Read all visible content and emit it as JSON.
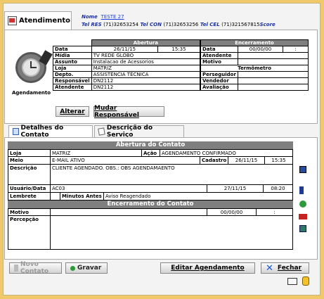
{
  "header": {
    "tab_label": "Atendimento",
    "nome_label": "Nome",
    "nome_value": "TESTE 27",
    "tel_res_label": "Tel RES",
    "tel_res_value": "(71)32653254",
    "tel_con_label": "Tel CON",
    "tel_con_value": "(71)32653256",
    "tel_cel_label": "Tel CEL",
    "tel_cel_value": "(71)321567815",
    "score_label": "Score"
  },
  "agendamento": {
    "label": "Agendamento",
    "abertura_header": "Abertura",
    "encerramento_header": "Encerramento",
    "termometro_header": "Termômetro",
    "data_label": "Data",
    "data_value": "26/11/15",
    "hora_value": "15:35",
    "midia_label": "Mídia",
    "midia_value": "TV REDE GLOBO",
    "assunto_label": "Assunto",
    "assunto_value": "Instalacao de Acessorios",
    "loja_label": "Loja",
    "loja_value": "MATRIZ",
    "depto_label": "Depto.",
    "depto_value": "ASSISTÊNCIA TÉCNICA",
    "responsavel_label": "Responsável",
    "responsavel_value": "DN2112",
    "atendente_label": "Atendente",
    "atendente_value": "DN2112",
    "enc_data_label": "Data",
    "enc_data_value": "00/00/00",
    "enc_hora_value": ":",
    "enc_atendente_label": "Atendente",
    "enc_motivo_label": "Motivo",
    "perseguidor_label": "Perseguidor",
    "vendedor_label": "Vendedor",
    "avaliacao_label": "Avaliação",
    "alterar_button": "Alterar",
    "mudar_button": "Mudar Responsável"
  },
  "tabs": {
    "detalhes": "Detalhes do Contato",
    "descricao": "Descrição do Serviço"
  },
  "contato": {
    "abertura_header": "Abertura do Contato",
    "loja_label": "Loja",
    "loja_value": "MATRIZ",
    "acao_label": "Ação",
    "acao_value": "AGENDAMENTO CONFIRMADO",
    "meio_label": "Meio",
    "meio_value": "E-MAIL ATIVO",
    "cadastro_label": "Cadastro",
    "cadastro_date": "26/11/15",
    "cadastro_time": "15:35",
    "descricao_label": "Descrição",
    "descricao_value": "CLIENTE AGENDADO. OBS.: OBS AGENDAMAENTO",
    "usuario_label": "Usuário/Data",
    "usuario_value": "AC03",
    "usuario_date": "27/11/15",
    "usuario_time": "08:20",
    "lembrete_label": "Lembrete",
    "minutos_label": "Minutos Antes",
    "minutos_value": "Aviso Reagendado",
    "encerramento_header": "Encerramento do Contato",
    "motivo_label": "Motivo",
    "motivo_date": "00/00/00",
    "motivo_time": ":",
    "percepcao_label": "Percepção"
  },
  "footer": {
    "novo_button": "Novo Contato",
    "gravar_button": "Gravar",
    "editar_button": "Editar Agendamento",
    "fechar_button": "Fechar"
  }
}
